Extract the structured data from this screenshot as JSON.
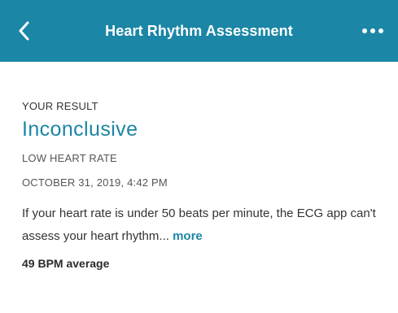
{
  "header": {
    "title": "Heart Rhythm Assessment",
    "back_icon": "chevron-left-icon",
    "menu_icon": "more-dots-icon",
    "background_color": "#1b86a5"
  },
  "result": {
    "label": "YOUR RESULT",
    "value": "Inconclusive",
    "value_color": "#1b86a5",
    "reason": "LOW HEART RATE",
    "timestamp": "OCTOBER 31, 2019, 4:42 PM"
  },
  "description": {
    "text": "If your heart rate is under 50 beats per minute, the ECG app can't assess your heart rhythm...",
    "more_label": "more"
  },
  "average": {
    "label": "49 BPM average"
  }
}
